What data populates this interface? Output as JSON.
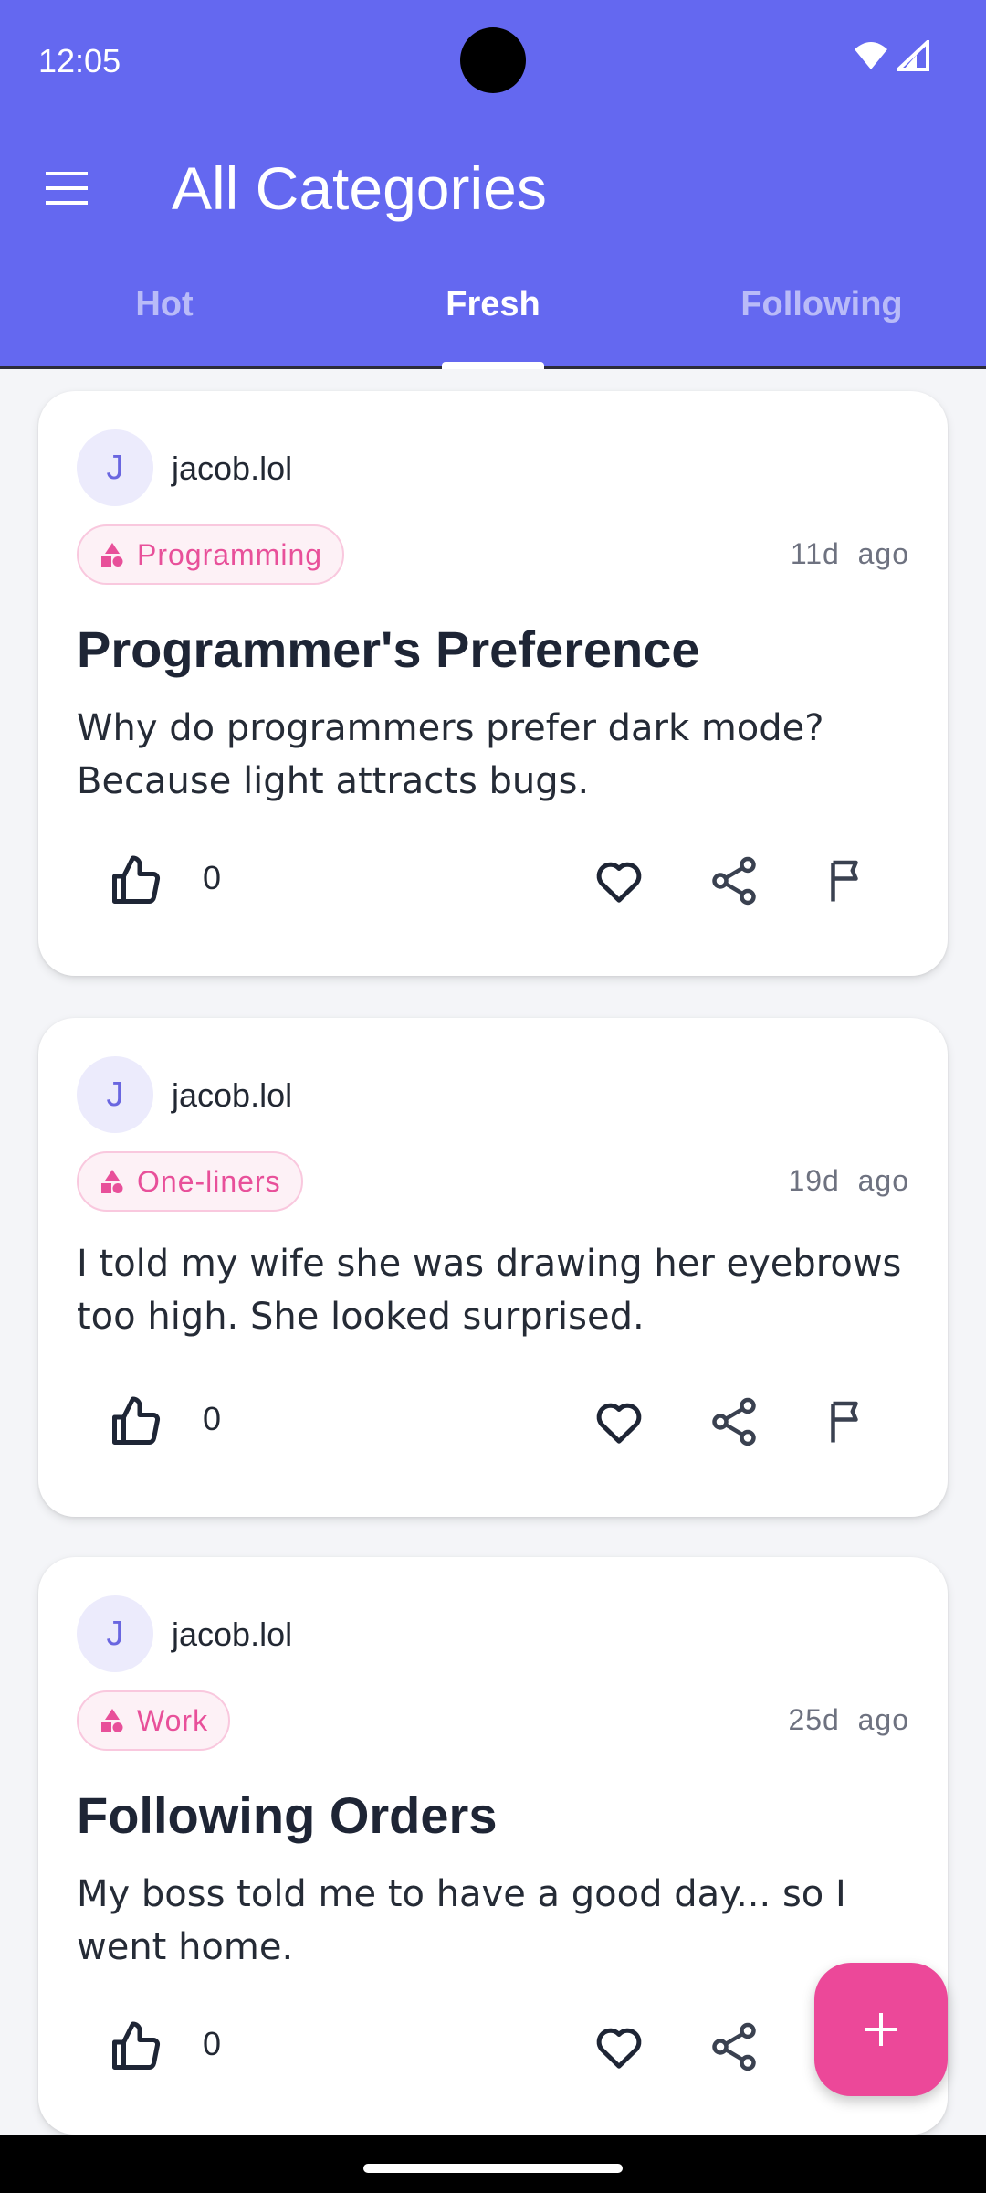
{
  "status_bar": {
    "time": "12:05"
  },
  "app_bar": {
    "title": "All Categories",
    "menu_icon": "menu-icon"
  },
  "tabs": [
    {
      "label": "Hot",
      "active": false
    },
    {
      "label": "Fresh",
      "active": true
    },
    {
      "label": "Following",
      "active": false
    }
  ],
  "posts": [
    {
      "avatar_letter": "J",
      "username": "jacob.lol",
      "category": "Programming",
      "age_value": "11d",
      "age_suffix": "ago",
      "title": "Programmer's Preference",
      "body": "Why do programmers prefer dark mode? Because light attracts bugs.",
      "likes": "0"
    },
    {
      "avatar_letter": "J",
      "username": "jacob.lol",
      "category": "One-liners",
      "age_value": "19d",
      "age_suffix": "ago",
      "title": "",
      "body": "I told my wife she was drawing her eyebrows too high. She looked surprised.",
      "likes": "0"
    },
    {
      "avatar_letter": "J",
      "username": "jacob.lol",
      "category": "Work",
      "age_value": "25d",
      "age_suffix": "ago",
      "title": "Following Orders",
      "body": "My boss told me to have a good day... so I went home.",
      "likes": "0"
    }
  ],
  "colors": {
    "primary": "#6468F0",
    "accent": "#EC4899",
    "chip_text": "#E8509A",
    "title_text": "#1E2535"
  },
  "fab": {
    "icon": "plus-icon"
  }
}
